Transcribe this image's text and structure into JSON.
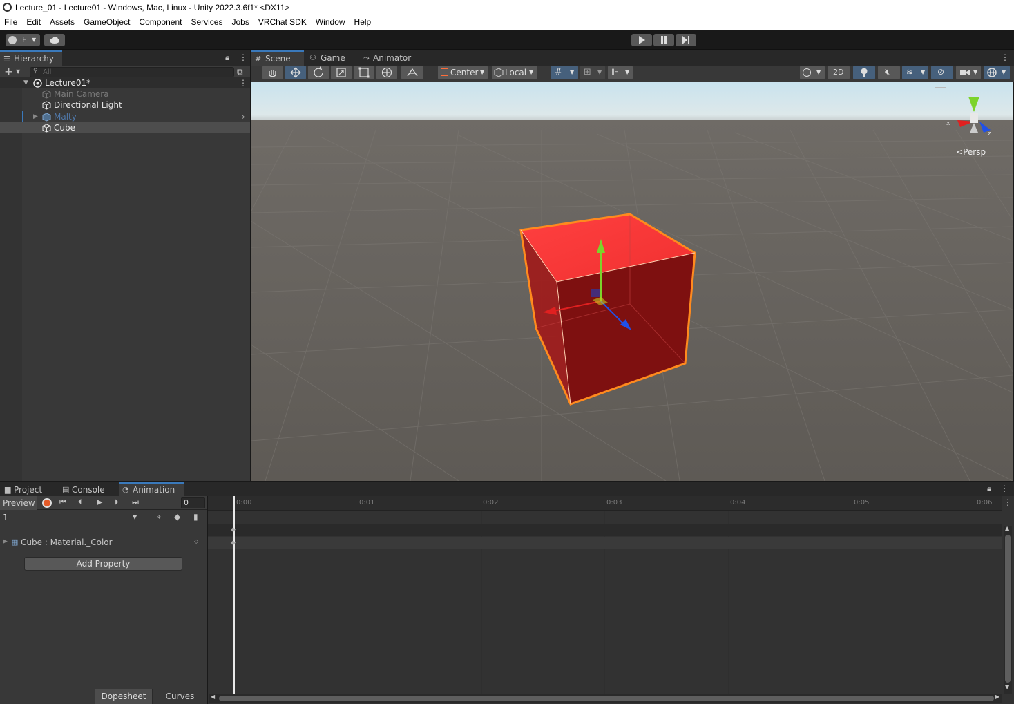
{
  "window": {
    "title": "Lecture_01 - Lecture01 - Windows, Mac, Linux - Unity 2022.3.6f1* <DX11>"
  },
  "menu": [
    "File",
    "Edit",
    "Assets",
    "GameObject",
    "Component",
    "Services",
    "Jobs",
    "VRChat SDK",
    "Window",
    "Help"
  ],
  "toolbar": {
    "account_label": "F"
  },
  "hierarchy": {
    "tab_label": "Hierarchy",
    "search_placeholder": "All",
    "scene_name": "Lecture01*",
    "items": [
      {
        "label": "Main Camera",
        "state": "disabled"
      },
      {
        "label": "Directional Light",
        "state": "normal"
      },
      {
        "label": "Malty",
        "state": "prefab"
      },
      {
        "label": "Cube",
        "state": "selected"
      }
    ]
  },
  "scene_tabs": [
    {
      "label": "Scene",
      "icon": "grid-icon",
      "active": true
    },
    {
      "label": "Game",
      "icon": "gamepad-icon",
      "active": false
    },
    {
      "label": "Animator",
      "icon": "animator-icon",
      "active": false
    }
  ],
  "scene_toolbar": {
    "pivot_label": "Center",
    "space_label": "Local",
    "mode_2d_label": "2D"
  },
  "scene_view": {
    "projection_label": "Persp",
    "gizmo_axes": {
      "x": "x",
      "y": "y",
      "z": "z"
    },
    "selected_color": "#ff3a3a",
    "outline_color": "#ff8a1e"
  },
  "bottom_tabs": [
    {
      "label": "Project",
      "icon": "folder-icon",
      "active": false
    },
    {
      "label": "Console",
      "icon": "console-icon",
      "active": false
    },
    {
      "label": "Animation",
      "icon": "clock-icon",
      "active": true
    }
  ],
  "animation": {
    "preview_label": "Preview",
    "frame_value": "0",
    "clip_name": "1",
    "property_label": "Cube : Material._Color",
    "add_property_label": "Add Property",
    "dopesheet_label": "Dopesheet",
    "curves_label": "Curves",
    "ruler_labels": [
      "0:00",
      "0:01",
      "0:02",
      "0:03",
      "0:04",
      "0:05",
      "0:06"
    ]
  }
}
